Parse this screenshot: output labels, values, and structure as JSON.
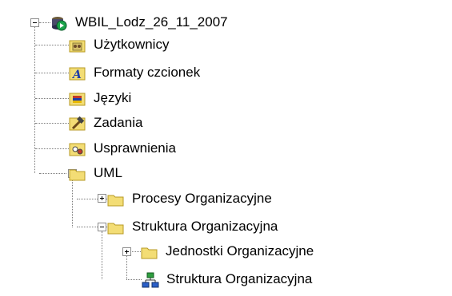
{
  "tree": {
    "root": {
      "label": "WBIL_Lodz_26_11_2007",
      "icon": "database-globe-icon",
      "expanded": true
    },
    "items": [
      {
        "label": "Użytkownicy",
        "icon": "users-folder-icon"
      },
      {
        "label": "Formaty czcionek",
        "icon": "font-format-icon"
      },
      {
        "label": "Języki",
        "icon": "languages-icon"
      },
      {
        "label": "Zadania",
        "icon": "tasks-hammer-icon"
      },
      {
        "label": "Usprawnienia",
        "icon": "improvements-icon"
      },
      {
        "label": "UML",
        "icon": "folder-icon",
        "expanded": true
      },
      {
        "label": "Procesy Organizacyjne",
        "icon": "folder-icon",
        "expanded": false
      },
      {
        "label": "Struktura Organizacyjna",
        "icon": "folder-icon",
        "expanded": true
      },
      {
        "label": "Jednostki Organizacyjne",
        "icon": "folder-icon",
        "expanded": false
      },
      {
        "label": "Struktura Organizacyjna",
        "icon": "org-chart-icon"
      }
    ]
  },
  "colors": {
    "folder": "#f3dd75",
    "folder_edge": "#b79a24",
    "connector": "#7a7a7a"
  }
}
